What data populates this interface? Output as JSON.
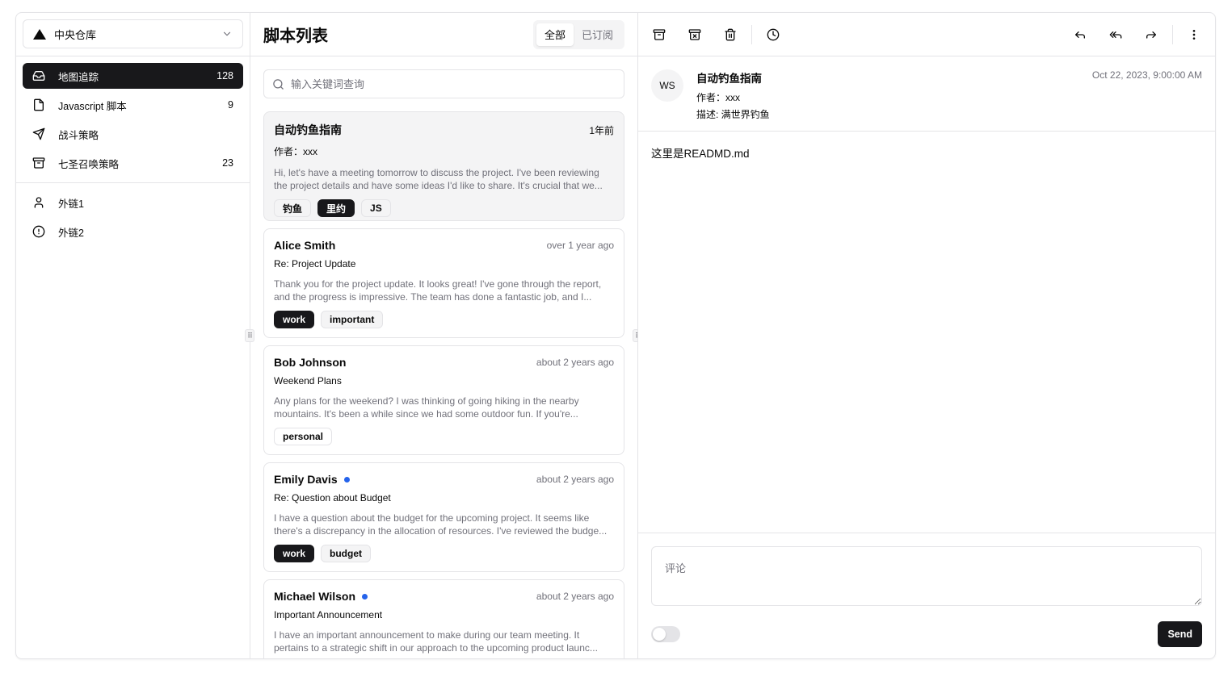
{
  "account": {
    "name": "中央仓库"
  },
  "nav": [
    {
      "label": "地图追踪",
      "count": "128",
      "icon": "inbox-icon"
    },
    {
      "label": "Javascript 脚本",
      "count": "9",
      "icon": "file-icon"
    },
    {
      "label": "战斗策略",
      "count": "",
      "icon": "send-icon"
    },
    {
      "label": "七圣召唤策略",
      "count": "23",
      "icon": "archive-icon"
    }
  ],
  "nav2": [
    {
      "label": "外链1",
      "icon": "user-icon"
    },
    {
      "label": "外链2",
      "icon": "alert-circle-icon"
    }
  ],
  "list": {
    "title": "脚本列表",
    "tabs": [
      "全部",
      "已订阅"
    ],
    "search_placeholder": "输入关键词查询"
  },
  "cards": [
    {
      "name": "自动钓鱼指南",
      "date": "1年前",
      "subject": "作者：xxx",
      "preview": "Hi, let's have a meeting tomorrow to discuss the project. I've been reviewing the project details and have some ideas I'd like to share. It's crucial that we...",
      "labels": [
        "钓鱼",
        "里约",
        "JS"
      ]
    },
    {
      "name": "Alice Smith",
      "date": "over 1 year ago",
      "subject": "Re: Project Update",
      "preview": "Thank you for the project update. It looks great! I've gone through the report, and the progress is impressive. The team has done a fantastic job, and I...",
      "labels": [
        "work",
        "important"
      ]
    },
    {
      "name": "Bob Johnson",
      "date": "about 2 years ago",
      "subject": "Weekend Plans",
      "preview": "Any plans for the weekend? I was thinking of going hiking in the nearby mountains. It's been a while since we had some outdoor fun. If you're...",
      "labels": [
        "personal"
      ]
    },
    {
      "name": "Emily Davis",
      "date": "about 2 years ago",
      "subject": "Re: Question about Budget",
      "preview": "I have a question about the budget for the upcoming project. It seems like there's a discrepancy in the allocation of resources. I've reviewed the budge...",
      "labels": [
        "work",
        "budget"
      ]
    },
    {
      "name": "Michael Wilson",
      "date": "about 2 years ago",
      "subject": "Important Announcement",
      "preview": "I have an important announcement to make during our team meeting. It pertains to a strategic shift in our approach to the upcoming product launc...",
      "labels": [
        "",
        "",
        ""
      ]
    }
  ],
  "detail": {
    "avatar": "WS",
    "title": "自动钓鱼指南",
    "author": "作者：xxx",
    "description": "描述: 满世界钓鱼",
    "date": "Oct 22, 2023, 9:00:00 AM",
    "body": "这里是READMD.md",
    "comment_placeholder": "评论",
    "send_label": "Send"
  },
  "colors": {
    "accent": "#18181b",
    "unread_dot": "#2563eb",
    "border": "#e4e4e7",
    "muted": "#71717a"
  }
}
